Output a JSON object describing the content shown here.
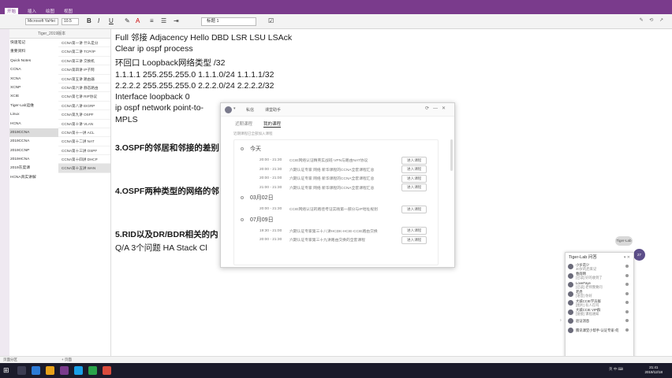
{
  "ribbon": {
    "tabs": [
      "开始",
      "插入",
      "绘图",
      "视图"
    ],
    "active_tab": "开始",
    "font_name": "Microsoft YaHei",
    "font_size": "10.5",
    "style_name": "标题 1",
    "bold": "B",
    "italic": "I",
    "underline": "U"
  },
  "nav": {
    "search_placeholder": "Tiger_2019版本",
    "notebooks": [
      {
        "label": "快速笔记",
        "color": "#c0392b"
      },
      {
        "label": "重要资料",
        "color": "#e67e22"
      },
      {
        "label": "Quick Notes",
        "color": "#8e44ad"
      },
      {
        "label": "CCNA",
        "color": "#2980b9"
      },
      {
        "label": "XCNA",
        "color": "#27ae60"
      },
      {
        "label": "XCNP",
        "color": "#16a085"
      },
      {
        "label": "XCIE",
        "color": "#d35400"
      },
      {
        "label": "Tiger-Lab运维",
        "color": "#7f8c8d"
      },
      {
        "label": "Linux",
        "color": "#2c3e50"
      },
      {
        "label": "HCNA",
        "color": "#c0392b"
      },
      {
        "label": "2019CCNA",
        "color": "#9b59b6"
      },
      {
        "label": "2019CCNA",
        "color": "#3498db"
      },
      {
        "label": "2019CCNP",
        "color": "#1abc9c"
      },
      {
        "label": "2019HCNA",
        "color": "#e74c3c"
      },
      {
        "label": "2019灰度课",
        "color": "#f39c12"
      },
      {
        "label": "HCNA真实讲解",
        "color": "#34495e"
      }
    ],
    "active_notebook": 10,
    "pages": [
      "CCNA第一讲 什么是分",
      "CCNA第二讲 TCP/IP",
      "CCNA第三讲 交换机",
      "CCNA第四讲 IP子网",
      "CCNA第五讲 路由器",
      "CCNA第六讲 静态路由",
      "CCNA第七讲 RIP协议",
      "CCNA第八讲 EIGRP",
      "CCNA第九讲 OSPF",
      "CCNA第十讲 VLAN",
      "CCNA第十一讲 ACL",
      "CCNA第十二讲 NAT",
      "CCNA第十三讲 OSPF",
      "CCNA第十四讲 DHCP",
      "CCNA第十五讲 WAN"
    ],
    "active_page": 14
  },
  "note": {
    "lines": [
      {
        "text": "Full          邻接 Adjacency   Hello DBD LSR LSU LSAck",
        "style": "n"
      },
      {
        "text": "Clear ip ospf process",
        "style": "n"
      },
      {
        "text": "环回口 Loopback网络类型 /32",
        "style": "n"
      },
      {
        "text": "1.1.1.1 255.255.255.0              1.1.1.0/24     1.1.1.1/32",
        "style": "n"
      },
      {
        "text": "2.2.2.2 255.255.255.0              2.2.2.0/24     2.2.2.2/32",
        "style": "n"
      },
      {
        "text": "Interface loopback 0",
        "style": "n"
      },
      {
        "text": " ip ospf network point-to-",
        "style": "n"
      },
      {
        "text": "MPLS",
        "style": "n"
      },
      {
        "text": "3.OSPF的邻居和邻接的差别",
        "style": "hd"
      },
      {
        "text": "4.OSPF两种类型的网络的邻",
        "style": "hd"
      },
      {
        "text": "5.RID以及DR/BDR相关的内",
        "style": "hd"
      },
      {
        "text": "Q/A 3个问题   HA  Stack Cl",
        "style": "n"
      }
    ]
  },
  "chat": {
    "msg_label": "私信",
    "pc_label": "课堂助手",
    "tabs": [
      "近期课程",
      "我的课程"
    ],
    "active_tab": 1,
    "tag": "近期课程已全部加入课程",
    "groups": [
      {
        "day": "今天",
        "events": [
          {
            "time": "20:00 - 21:30",
            "desc": "CCIE网络认证精英实战班-VPN与路由NAT协议",
            "btn": "进入课程"
          },
          {
            "time": "20:00 - 21:30",
            "desc": "六期认证专家 网络 新华课程的CCNA全套课程汇总",
            "btn": "进入课程"
          },
          {
            "time": "20:00 - 21:00",
            "desc": "六期认证专家 网络 新华课程的CCNA全套课程汇总",
            "btn": "进入课程"
          },
          {
            "time": "21:00 - 21:30",
            "desc": "六期认证专家 网络 新华课程的CCNA全套课程汇总",
            "btn": "进入课程"
          }
        ]
      },
      {
        "day": "03月02日",
        "events": [
          {
            "time": "20:00 - 21:30",
            "desc": "CCIE网络认证的路径考证实践第一部分与IP地址规划",
            "btn": "进入课程"
          }
        ]
      },
      {
        "day": "07月09日",
        "events": [
          {
            "time": "19:30 - 21:00",
            "desc": "六期认证专家第三十八讲HCDK-HCIE-CCIE路由交换",
            "btn": "进入课程"
          },
          {
            "time": "20:00 - 21:30",
            "desc": "六期认证专家第三十九讲路由交换的全套课程",
            "btn": "进入课程"
          }
        ]
      }
    ]
  },
  "friends": {
    "title": "Tiger-Lab 问答",
    "badge": "Tiger-Lab",
    "bubble": "27",
    "items": [
      {
        "name": "小岁花少",
        "status": "40岁的后来记"
      },
      {
        "name": "春雨晴",
        "status": "[已读] 好的收到了"
      },
      {
        "name": "LoveFaye",
        "status": "[已读] 老师我要问"
      },
      {
        "name": "老虎",
        "status": "[语音] 你好"
      },
      {
        "name": "大城CCIE学员群",
        "status": "[图片] 有人在吗"
      },
      {
        "name": "大城CCIE VIP群",
        "status": "[链接] 课程通知"
      },
      {
        "name": "验证消息",
        "status": ""
      },
      {
        "name": "腾讯课堂小帮手-认证专家-何",
        "status": ""
      }
    ],
    "footer": "已收合并"
  },
  "status": {
    "left": "页面分区",
    "right": "+ 页面"
  },
  "taskbar": {
    "tray": "英 中 ⌨",
    "time": "21:41",
    "date": "2019/12/18"
  },
  "icons": {
    "bold": "bold-icon",
    "back": "arrow-left-icon",
    "search": "search-icon",
    "refresh": "refresh-icon",
    "minimize": "minimize-icon",
    "close": "close-icon"
  }
}
